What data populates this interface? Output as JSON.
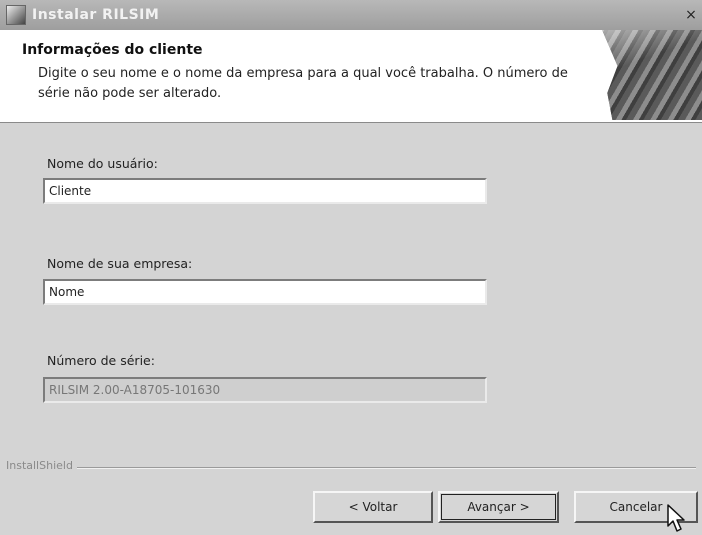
{
  "window": {
    "title": "Instalar RILSIM",
    "close_glyph": "×",
    "app_icon": "installer-icon"
  },
  "header": {
    "title": "Informações do cliente",
    "description": "Digite o seu nome e o nome da empresa para a qual você trabalha. O número de série não pode ser alterado."
  },
  "form": {
    "user_name": {
      "label": "Nome do usuário:",
      "value": "Cliente"
    },
    "company_name": {
      "label": "Nome de sua empresa:",
      "value": "Nome"
    },
    "serial_number": {
      "label": "Número de série:",
      "value": "RILSIM 2.00-A18705-101630"
    }
  },
  "footer": {
    "brand": "InstallShield",
    "back_label": "< Voltar",
    "next_label": "Avançar >",
    "cancel_label": "Cancelar"
  }
}
